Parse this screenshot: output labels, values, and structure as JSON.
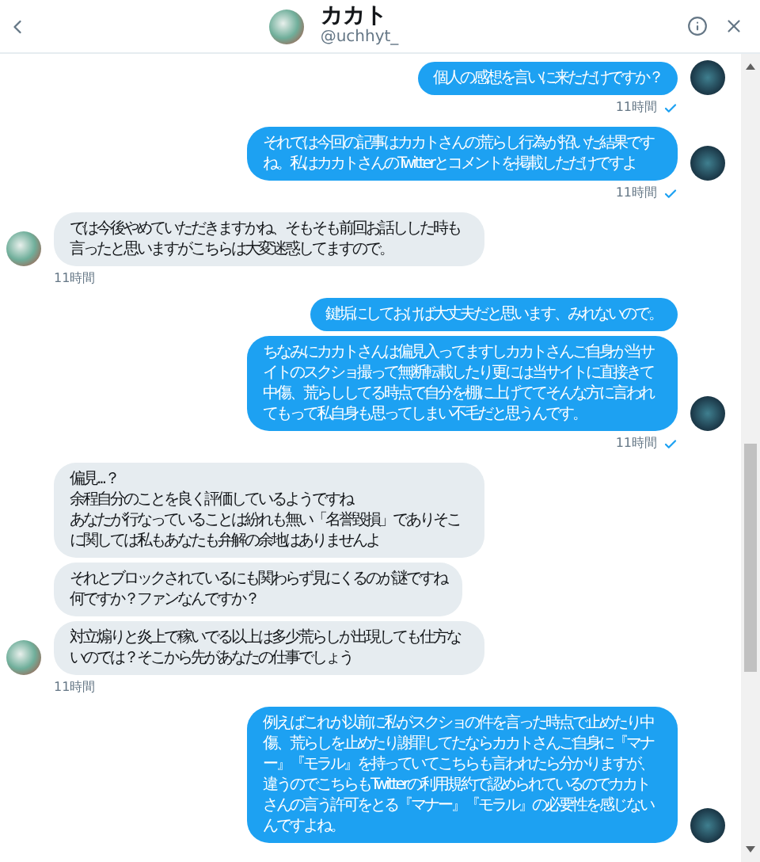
{
  "header": {
    "name": "カカト",
    "handle": "@uchhyt_"
  },
  "messages": [
    {
      "kind": "outgoing",
      "bubbles": [
        [
          "個人の感想を言いに来ただけですか？"
        ]
      ],
      "time": "11時間",
      "read": true
    },
    {
      "kind": "outgoing",
      "bubbles": [
        [
          "それでは今回の記事はカカトさんの荒らし行為が招いた結果ですね。私はカカトさんのTwitterとコメントを掲載しただけですよ"
        ]
      ],
      "time": "11時間",
      "read": true
    },
    {
      "kind": "incoming",
      "bubbles": [
        [
          "では今後やめていただきますかね、そもそも前回お話しした時も言ったと思いますがこちらは大変迷惑してますので。"
        ]
      ],
      "time": "11時間"
    },
    {
      "kind": "outgoing",
      "bubbles": [
        [
          "鍵垢にしておけば大丈夫だと思います、みれないので。"
        ],
        [
          "ちなみにカカトさんは偏見入ってますしカカトさんご自身が当サイトのスクショ撮って無断転載したり更には当サイトに直接きて中傷、荒らししてる時点で自分を棚に上げててそんな方に言われてもって私自身も思ってしまい不毛だと思うんです。"
        ]
      ],
      "time": "11時間",
      "read": true
    },
    {
      "kind": "incoming",
      "bubbles": [
        [
          "偏見...？",
          "余程自分のことを良く評価しているようですね",
          "あなたが行なっていることは紛れも無い「名誉毀損」でありそこに関しては私もあなたも弁解の余地はありませんよ"
        ],
        [
          "それとブロックされているにも関わらず見にくるのが謎ですね",
          "何ですか？ファンなんですか？"
        ],
        [
          "対立煽りと炎上で稼いでる以上は多少荒らしが出現しても仕方ないのでは？そこから先があなたの仕事でしょう"
        ]
      ],
      "time": "11時間"
    },
    {
      "kind": "outgoing",
      "bubbles": [
        [
          "例えばこれが以前に私がスクショの件を言った時点で止めたり中傷、荒らしを止めたり謝罪してたならカカトさんご自身に『マナー』『モラル』を持っていてこちらも言われたら分かりますが、違うのでこちらもTwitterの利用規約で認められているのでカカトさんの言う許可をとる『マナー』『モラル』の必要性を感じないんですよね。"
        ]
      ]
    }
  ]
}
